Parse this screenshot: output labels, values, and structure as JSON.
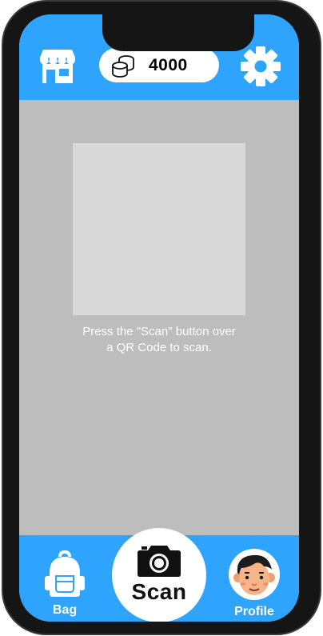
{
  "header": {
    "coins": "4000"
  },
  "scanner": {
    "instruction_line1": "Press the \"Scan\" button over",
    "instruction_line2": "a QR Code to scan."
  },
  "nav": {
    "bag_label": "Bag",
    "scan_label": "Scan",
    "profile_label": "Profile"
  },
  "colors": {
    "accent": "#2fa4ff",
    "background": "#bdbdbd",
    "scan_area": "#d9d9d9",
    "frame": "#151515"
  },
  "icons": {
    "shop": "storefront-icon",
    "coins": "coin-stack-icon",
    "settings": "gear-icon",
    "bag": "backpack-icon",
    "scan": "camera-icon",
    "profile": "avatar-icon"
  }
}
